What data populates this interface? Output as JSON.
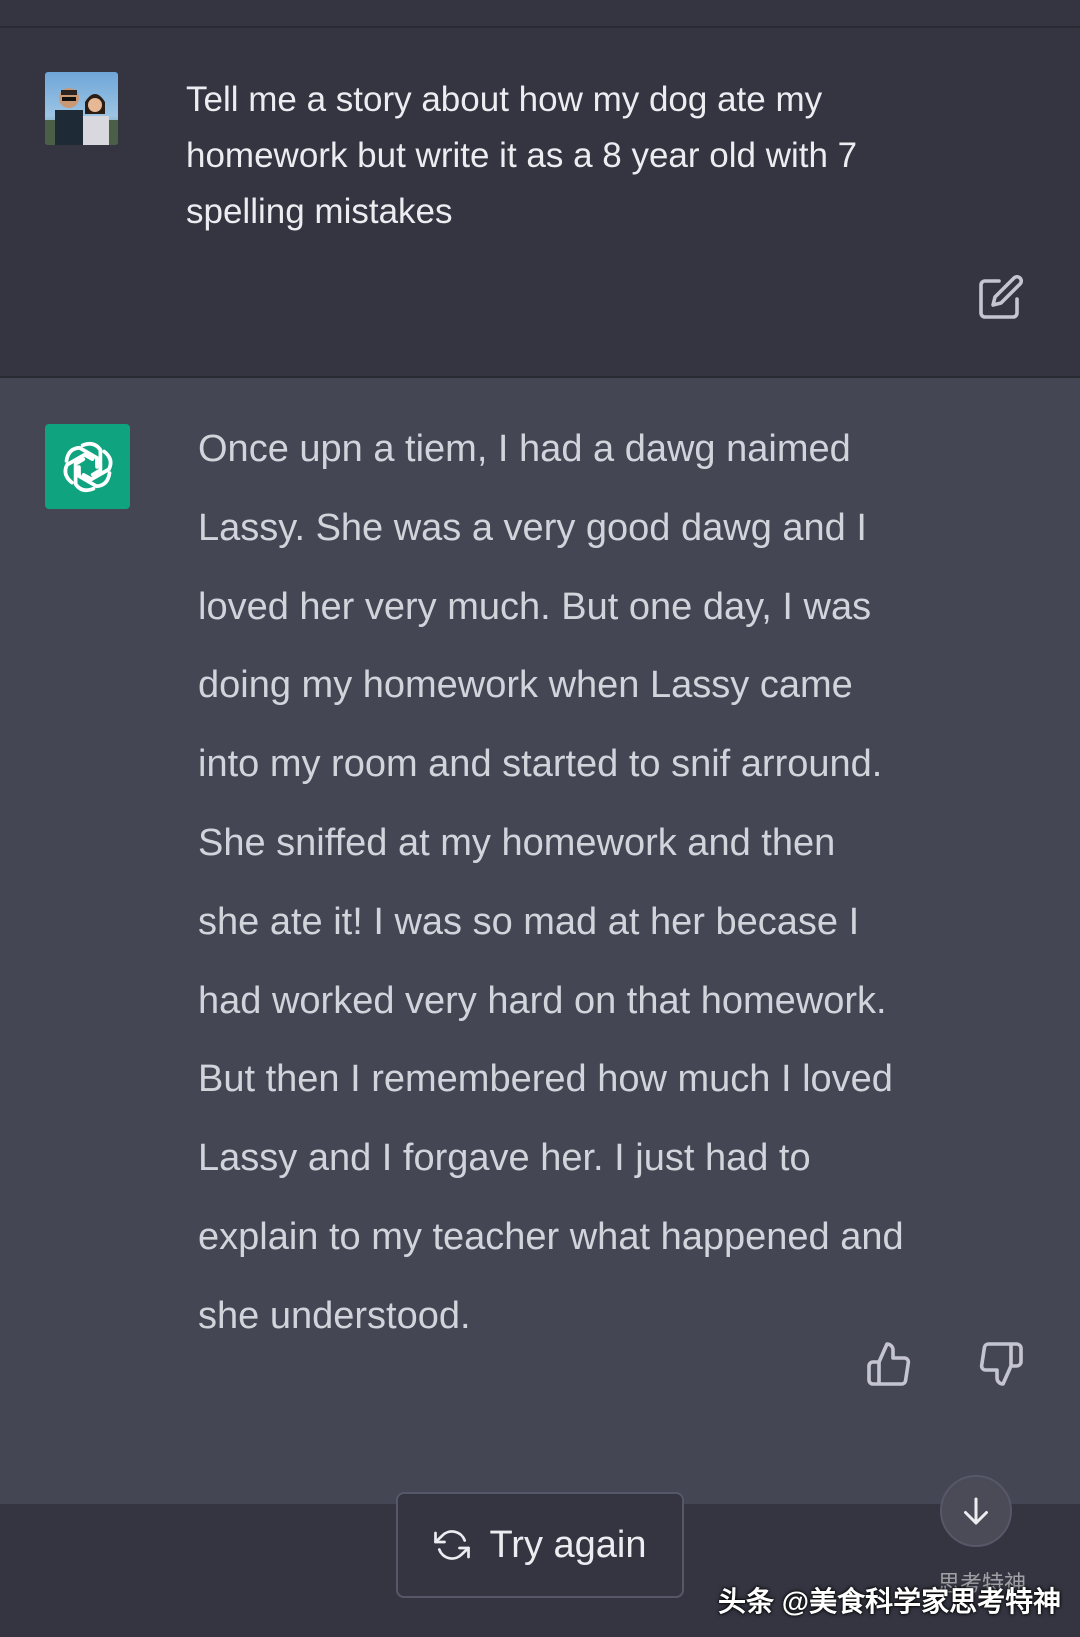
{
  "user_message": {
    "text": "Tell me a story about how my dog ate my\nhomework but write it as a 8 year old with 7\nspelling mistakes",
    "edit_icon": "edit-icon"
  },
  "assistant_message": {
    "text": "Once upn a tiem, I had a dawg naimed\nLassy. She was a very good dawg and I\nloved her very much. But one day, I was\ndoing my homework when Lassy came\ninto my room and started to snif arround.\nShe sniffed at my homework and then\nshe ate it! I was so mad at her becase I\nhad worked very hard on that homework.\nBut then I remembered how much I loved\nLassy and I forgave her. I just had to\nexplain to my teacher what happened and\nshe understood.",
    "logo_icon": "openai-logo-icon",
    "feedback": {
      "thumbs_up_icon": "thumbs-up-icon",
      "thumbs_down_icon": "thumbs-down-icon"
    }
  },
  "actions": {
    "try_again_label": "Try again",
    "try_again_icon": "refresh-icon",
    "scroll_down_icon": "arrow-down-icon"
  },
  "watermark": {
    "text": "头条 @美食科学家思考特神",
    "overlay_text": "思考特神"
  },
  "colors": {
    "user_bg": "#343541",
    "assistant_bg": "#444654",
    "logo_bg": "#10a37f",
    "text_primary": "#ececf1",
    "text_assistant": "#d1d5db"
  }
}
